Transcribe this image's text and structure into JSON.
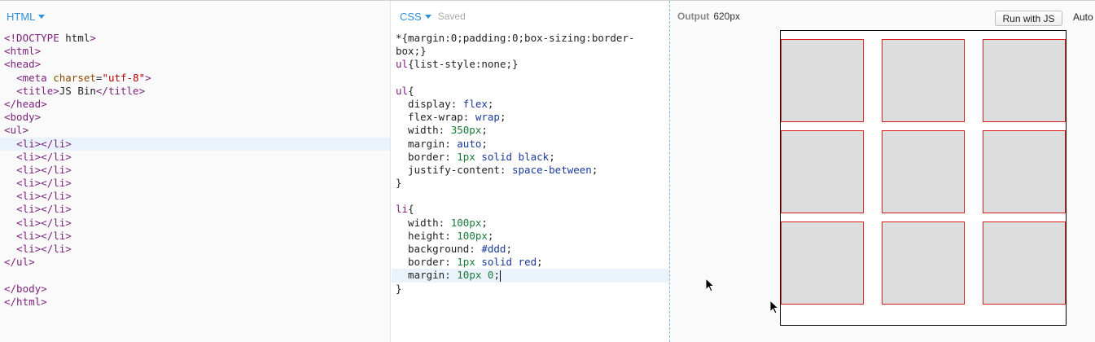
{
  "html_panel": {
    "title": "HTML",
    "lines": [
      "<!DOCTYPE html>",
      "<html>",
      "<head>",
      "  <meta charset=\"utf-8\">",
      "  <title>JS Bin</title>",
      "</head>",
      "<body>",
      "<ul>",
      "  <li></li>",
      "  <li></li>",
      "  <li></li>",
      "  <li></li>",
      "  <li></li>",
      "  <li></li>",
      "  <li></li>",
      "  <li></li>",
      "  <li></li>",
      "</ul>",
      "",
      "</body>",
      "</html>"
    ],
    "active_line": 8
  },
  "css_panel": {
    "title": "CSS",
    "status": "Saved",
    "lines": [
      "*{margin:0;padding:0;box-sizing:border-",
      "box;}",
      "ul{list-style:none;}",
      "",
      "ul{",
      "  display: flex;",
      "  flex-wrap: wrap;",
      "  width: 350px;",
      "  margin: auto;",
      "  border: 1px solid black;",
      "  justify-content: space-between;",
      "}",
      "",
      "li{",
      "  width: 100px;",
      "  height: 100px;",
      "  background: #ddd;",
      "  border: 1px solid red;",
      "  margin: 10px 0;",
      "}"
    ],
    "active_line": 18
  },
  "output_panel": {
    "label": "Output",
    "width_text": "620px",
    "run_button": "Run with JS",
    "auto_run": "Auto",
    "item_count": 9,
    "colors": {
      "box_fill": "#dddddd",
      "box_border": "#e02020"
    }
  }
}
